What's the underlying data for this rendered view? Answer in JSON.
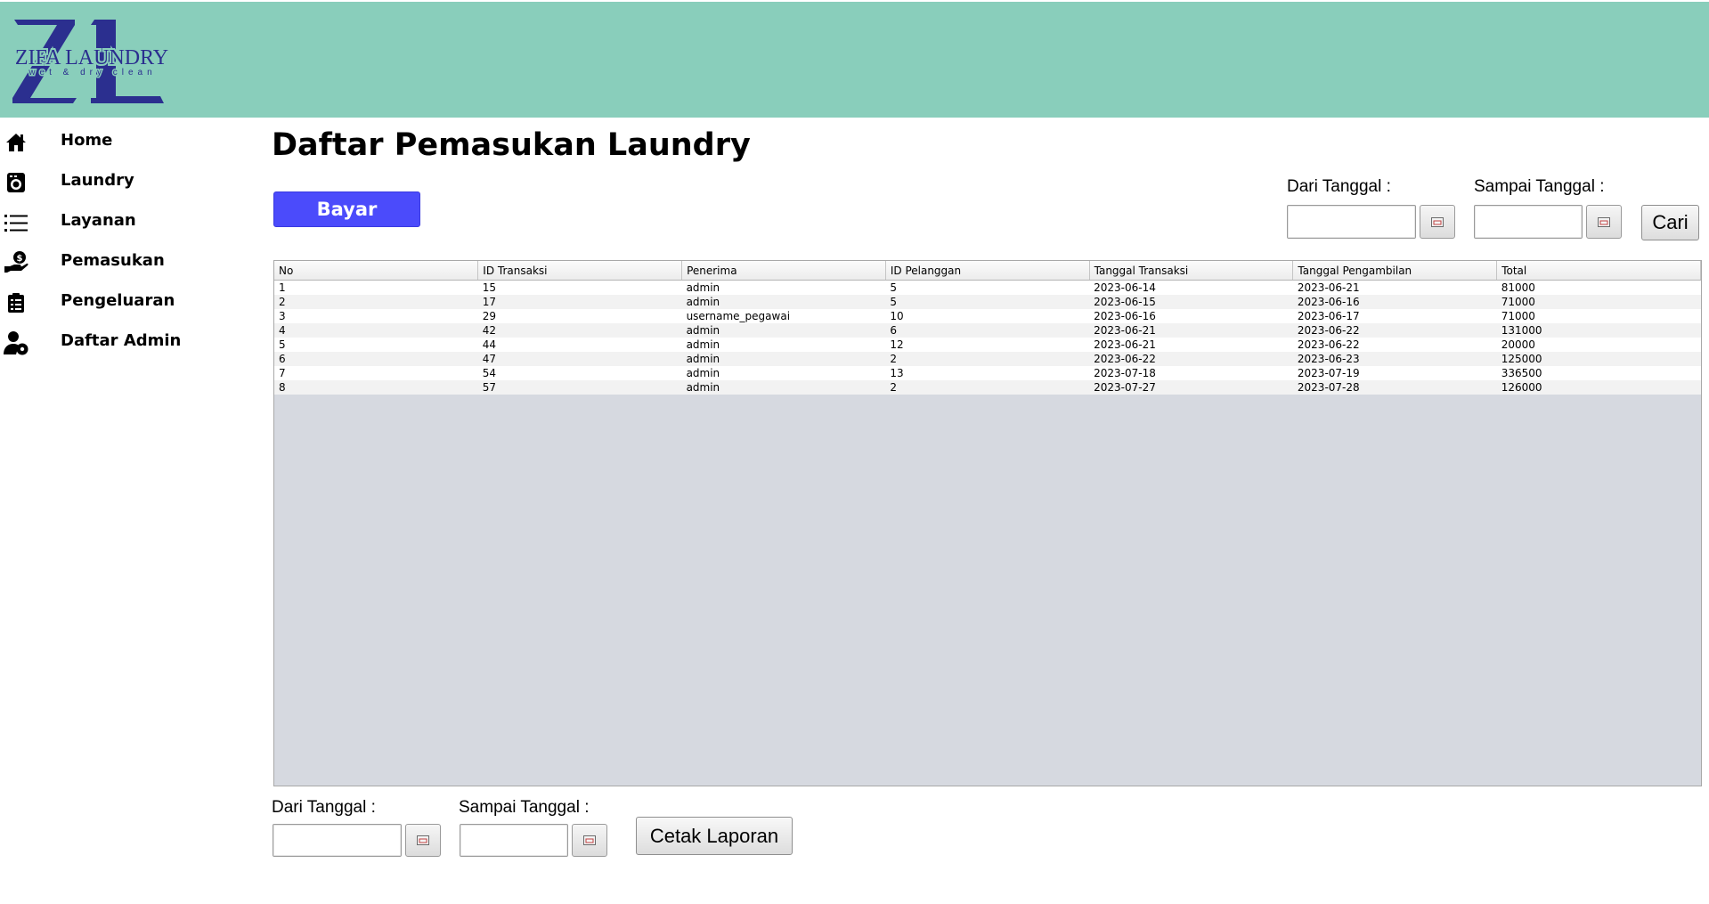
{
  "brand": {
    "logo_initials": "ZL",
    "name": "ZIFA LAUNDRY",
    "tagline": "wet & dry clean"
  },
  "sidebar": {
    "items": [
      {
        "label": "Home",
        "icon": "home-icon"
      },
      {
        "label": "Laundry",
        "icon": "washing-machine-icon"
      },
      {
        "label": "Layanan",
        "icon": "list-icon"
      },
      {
        "label": "Pemasukan",
        "icon": "hand-coin-icon"
      },
      {
        "label": "Pengeluaran",
        "icon": "clipboard-icon"
      },
      {
        "label": "Daftar Admin",
        "icon": "admin-user-icon"
      }
    ]
  },
  "main": {
    "title": "Daftar Pemasukan Laundry",
    "bayar_label": "Bayar",
    "filter": {
      "from_label": "Dari Tanggal :",
      "to_label": "Sampai Tanggal :",
      "from_value": "",
      "to_value": "",
      "search_label": "Cari"
    },
    "table": {
      "columns": [
        "No",
        "ID Transaksi",
        "Penerima",
        "ID Pelanggan",
        "Tanggal Transaksi",
        "Tanggal Pengambilan",
        "Total"
      ],
      "rows": [
        [
          "1",
          "15",
          "admin",
          "5",
          "2023-06-14",
          "2023-06-21",
          "81000"
        ],
        [
          "2",
          "17",
          "admin",
          "5",
          "2023-06-15",
          "2023-06-16",
          "71000"
        ],
        [
          "3",
          "29",
          "username_pegawai",
          "10",
          "2023-06-16",
          "2023-06-17",
          "71000"
        ],
        [
          "4",
          "42",
          "admin",
          "6",
          "2023-06-21",
          "2023-06-22",
          "131000"
        ],
        [
          "5",
          "44",
          "admin",
          "12",
          "2023-06-21",
          "2023-06-22",
          "20000"
        ],
        [
          "6",
          "47",
          "admin",
          "2",
          "2023-06-22",
          "2023-06-23",
          "125000"
        ],
        [
          "7",
          "54",
          "admin",
          "13",
          "2023-07-18",
          "2023-07-19",
          "336500"
        ],
        [
          "8",
          "57",
          "admin",
          "2",
          "2023-07-27",
          "2023-07-28",
          "126000"
        ]
      ]
    },
    "report": {
      "from_label": "Dari Tanggal :",
      "to_label": "Sampai Tanggal :",
      "from_value": "",
      "to_value": "",
      "print_label": "Cetak Laporan"
    }
  },
  "colors": {
    "header_bg": "#89cebb",
    "brand_navy": "#2b2f8f",
    "bayar_bg": "#4b4bfb",
    "table_empty_bg": "#d6d9e0"
  }
}
